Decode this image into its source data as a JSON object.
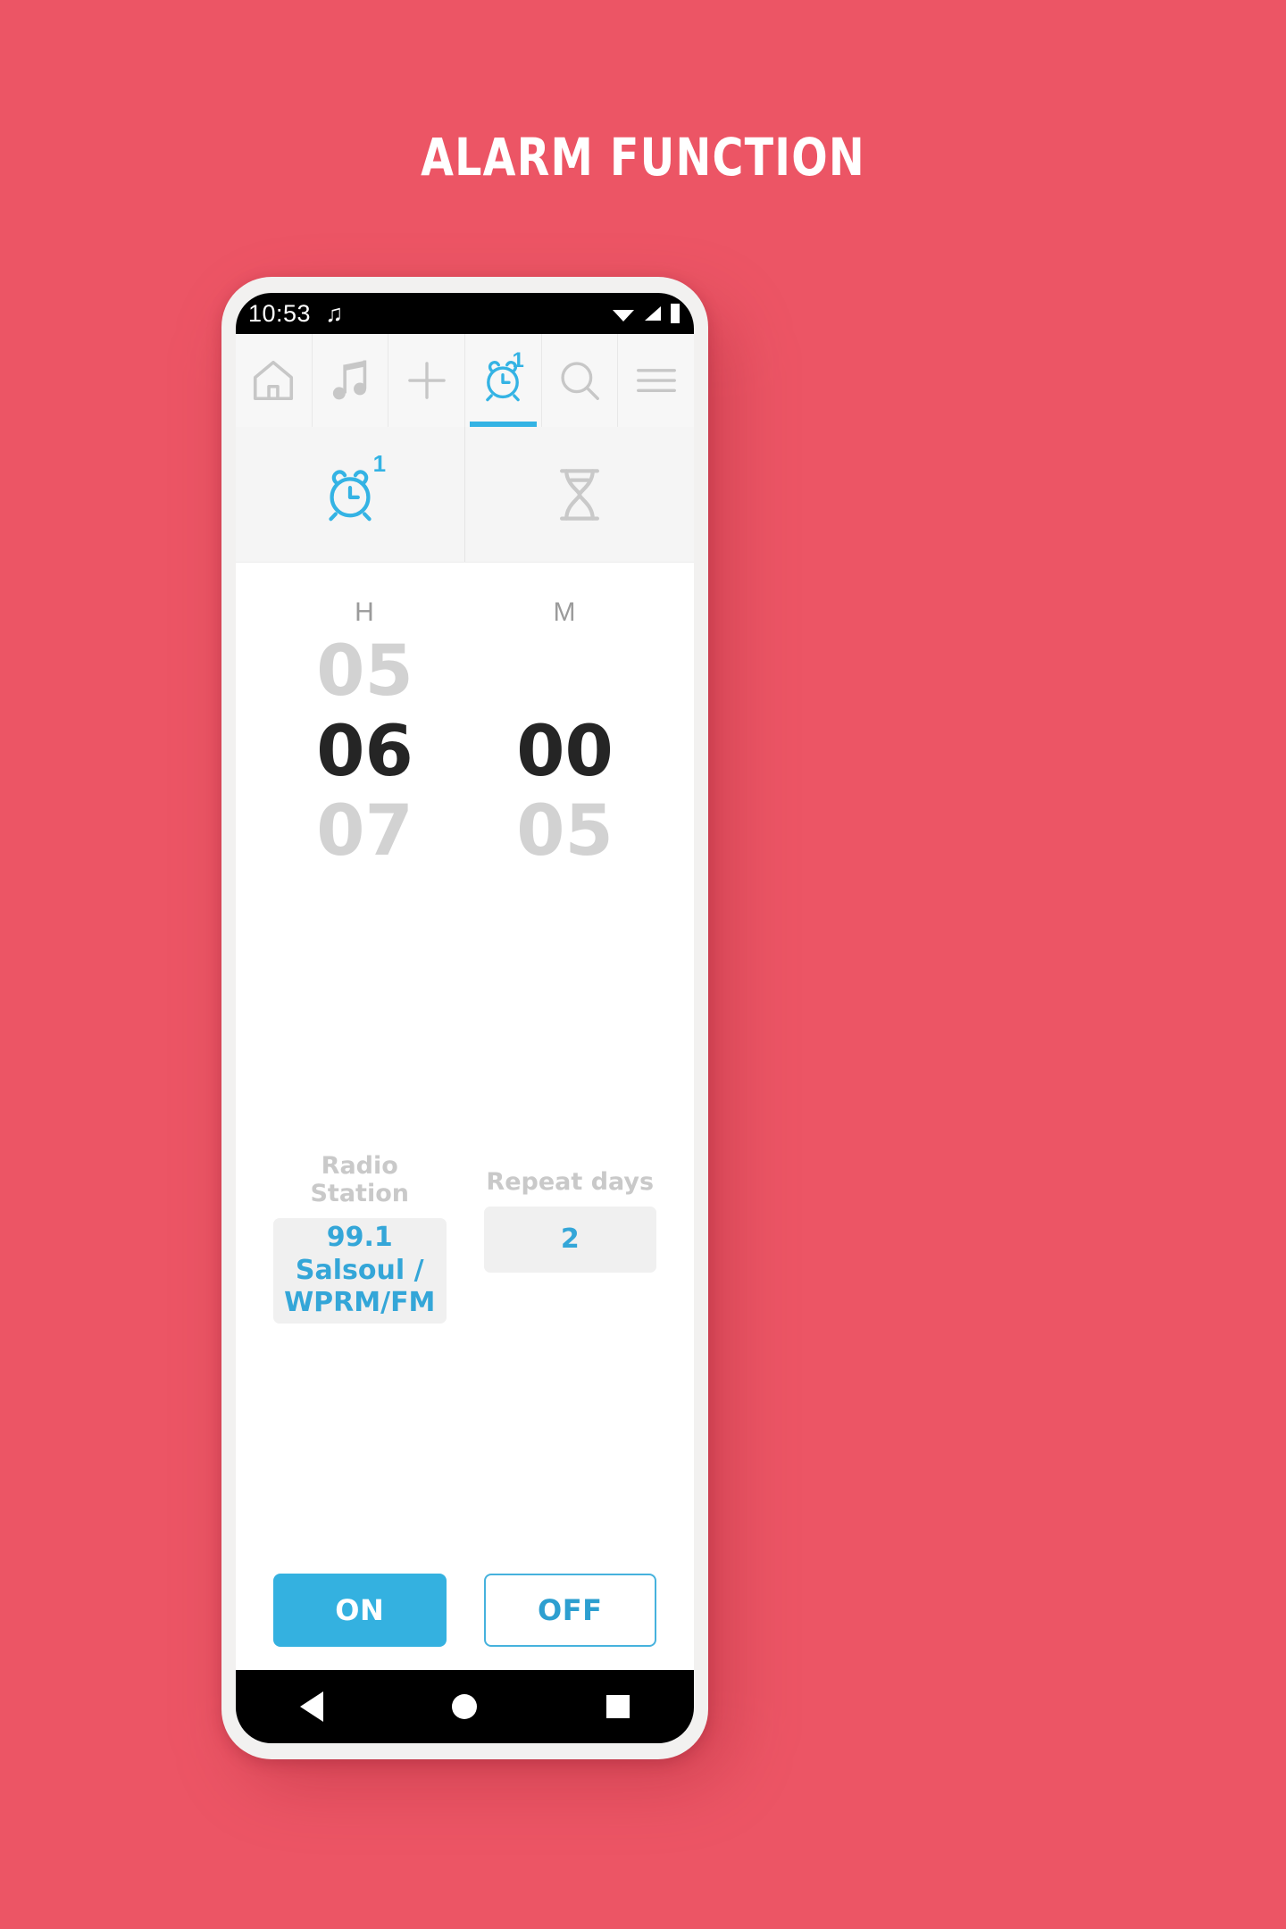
{
  "promo": {
    "title": "ALARM FUNCTION",
    "background_color": "#ec5565",
    "title_color": "#ffffff"
  },
  "theme": {
    "accent": "#34b3e4",
    "accent_dark": "#2d9fd0",
    "muted_text": "#c9c9c9",
    "selected_text": "#252525",
    "dim_text": "#d2d2d2",
    "field_bg": "#f0f0f0",
    "bar_bg": "#f7f7f7"
  },
  "status_bar": {
    "time": "10:53",
    "music_icon": "music-note-icon",
    "wifi_icon": "wifi-icon",
    "signal_icon": "cellular-signal-icon",
    "battery_icon": "battery-icon"
  },
  "navbar": {
    "items": [
      {
        "icon": "home-icon",
        "label": "Home",
        "active": false,
        "badge": ""
      },
      {
        "icon": "music-note-icon",
        "label": "Music",
        "active": false,
        "badge": ""
      },
      {
        "icon": "plus-icon",
        "label": "Add",
        "active": false,
        "badge": ""
      },
      {
        "icon": "alarm-clock-icon",
        "label": "Alarm",
        "active": true,
        "badge": "1"
      },
      {
        "icon": "search-icon",
        "label": "Search",
        "active": false,
        "badge": ""
      },
      {
        "icon": "hamburger-menu-icon",
        "label": "Menu",
        "active": false,
        "badge": ""
      }
    ]
  },
  "subtabs": {
    "items": [
      {
        "icon": "alarm-clock-icon",
        "label": "Alarm",
        "active": true,
        "badge": "1"
      },
      {
        "icon": "hourglass-icon",
        "label": "Timer",
        "active": false,
        "badge": ""
      }
    ]
  },
  "time_picker": {
    "hour": {
      "label": "H",
      "previous": "05",
      "selected": "06",
      "next": "07"
    },
    "minute": {
      "label": "M",
      "previous": "",
      "selected": "00",
      "next": "05"
    }
  },
  "fields": {
    "radio_station": {
      "label": "Radio Station",
      "value": "99.1 Salsoul / WPRM/FM"
    },
    "repeat_days": {
      "label": "Repeat days",
      "value": "2"
    }
  },
  "actions": {
    "on_label": "ON",
    "off_label": "OFF"
  },
  "soft_nav": {
    "back": "back-triangle-icon",
    "home": "home-circle-icon",
    "recents": "recents-square-icon"
  }
}
